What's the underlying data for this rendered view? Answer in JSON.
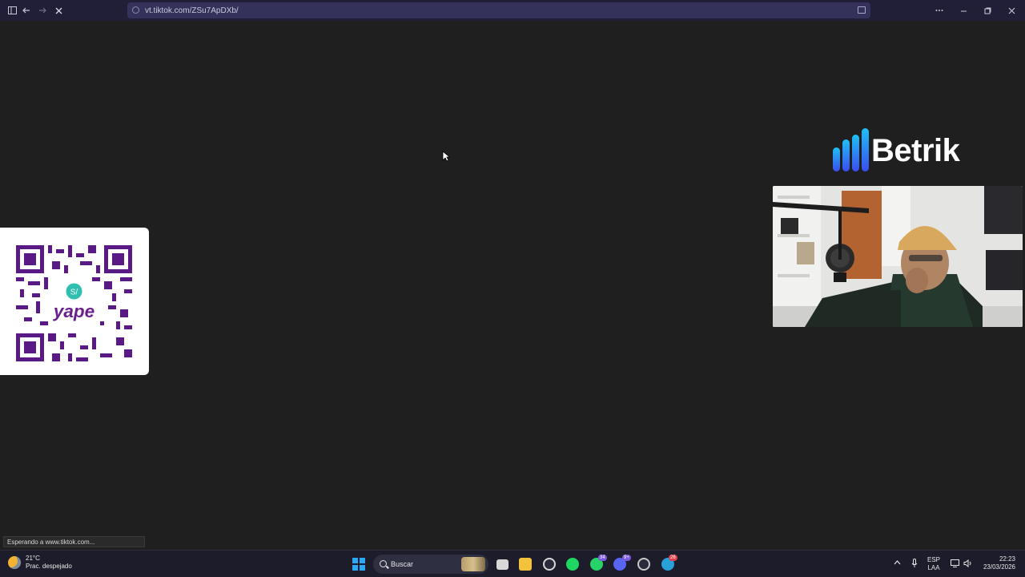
{
  "browser": {
    "url": "vt.tiktok.com/ZSu7ApDXb/",
    "status_text": "Esperando a www.tiktok.com..."
  },
  "overlay": {
    "brand_name": "Betrik",
    "qr_label": "yape",
    "qr_currency": "S/"
  },
  "taskbar": {
    "weather_temp": "21°C",
    "weather_desc": "Prac. despejado",
    "search_placeholder": "Buscar",
    "whatsapp_badge": "34",
    "discord_badge": "9+",
    "telegram_badge": "26",
    "lang_top": "ESP",
    "lang_bottom": "LAA",
    "time": "22:23",
    "date": "23/03/2026"
  },
  "colors": {
    "browser_bar": "#211f37",
    "page_bg": "#1f1f1f",
    "yape_purple": "#6a1f8f",
    "betrik_blue": "#2b7cf5"
  }
}
